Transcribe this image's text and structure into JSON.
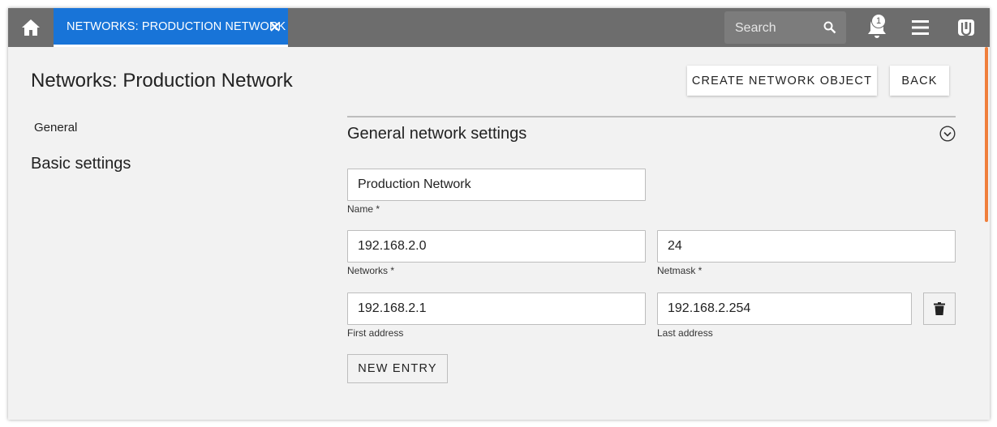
{
  "topbar": {
    "tab_label": "NETWORKS: PRODUCTION NETWORK",
    "search_placeholder": "Search",
    "notification_count": "1",
    "icons": {
      "home": "home-icon",
      "tab_close": "close-icon",
      "search": "search-icon",
      "notifications": "bell-icon",
      "menu": "hamburger-menu-icon",
      "brand": "brand-logo-icon"
    }
  },
  "header": {
    "title": "Networks: Production Network",
    "create_button": "CREATE NETWORK OBJECT",
    "back_button": "BACK"
  },
  "sidebar": {
    "general_label": "General",
    "basic_settings_label": "Basic settings"
  },
  "section": {
    "title": "General network settings",
    "collapse_icon": "chevron-circle-down-icon"
  },
  "form": {
    "name": {
      "value": "Production Network",
      "label": "Name *"
    },
    "network": {
      "value": "192.168.2.0",
      "label": "Networks *"
    },
    "netmask": {
      "value": "24",
      "label": "Netmask *"
    },
    "first_address": {
      "value": "192.168.2.1",
      "label": "First address"
    },
    "last_address": {
      "value": "192.168.2.254",
      "label": "Last address"
    },
    "delete_icon": "trash-icon",
    "new_entry_button": "NEW ENTRY"
  },
  "colors": {
    "topbar": "#6d6d6d",
    "active_tab": "#1874d8",
    "scrollbar": "#f07f3c",
    "background": "#f2f2f2"
  }
}
